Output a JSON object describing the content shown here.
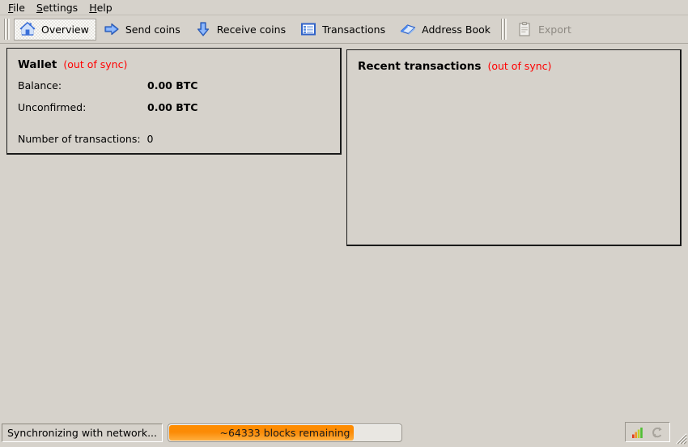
{
  "window": {
    "background_color": "#d6d2cb",
    "accent_color": "#ff8c00",
    "alert_color": "#ff0000"
  },
  "menubar": {
    "items": [
      {
        "name": "file",
        "accel": "F",
        "rest": "ile"
      },
      {
        "name": "settings",
        "accel": "S",
        "rest": "ettings"
      },
      {
        "name": "help",
        "accel": "H",
        "rest": "elp"
      }
    ]
  },
  "toolbar": {
    "buttons": [
      {
        "label": "Overview",
        "icon": "home-icon",
        "checked": true,
        "enabled": true
      },
      {
        "label": "Send coins",
        "icon": "arrow-right-icon",
        "checked": false,
        "enabled": true
      },
      {
        "label": "Receive coins",
        "icon": "arrow-down-icon",
        "checked": false,
        "enabled": true
      },
      {
        "label": "Transactions",
        "icon": "list-icon",
        "checked": false,
        "enabled": true
      },
      {
        "label": "Address Book",
        "icon": "book-icon",
        "checked": false,
        "enabled": true
      },
      {
        "label": "Export",
        "icon": "clipboard-icon",
        "checked": false,
        "enabled": false
      }
    ]
  },
  "wallet": {
    "title": "Wallet",
    "sync_status": "(out of sync)",
    "balance_label": "Balance:",
    "balance_value": "0.00 BTC",
    "unconfirmed_label": "Unconfirmed:",
    "unconfirmed_value": "0.00 BTC",
    "transactions_label": "Number of transactions:",
    "transactions_value": "0"
  },
  "recent_transactions": {
    "title": "Recent transactions",
    "sync_status": "(out of sync)",
    "items": []
  },
  "statusbar": {
    "status_text": "Synchronizing with network...",
    "progress_text": "~64333 blocks remaining",
    "progress_percent": 80,
    "connection_icon": "signal-bars-icon",
    "sync_icon": "sync-arrows-icon"
  }
}
